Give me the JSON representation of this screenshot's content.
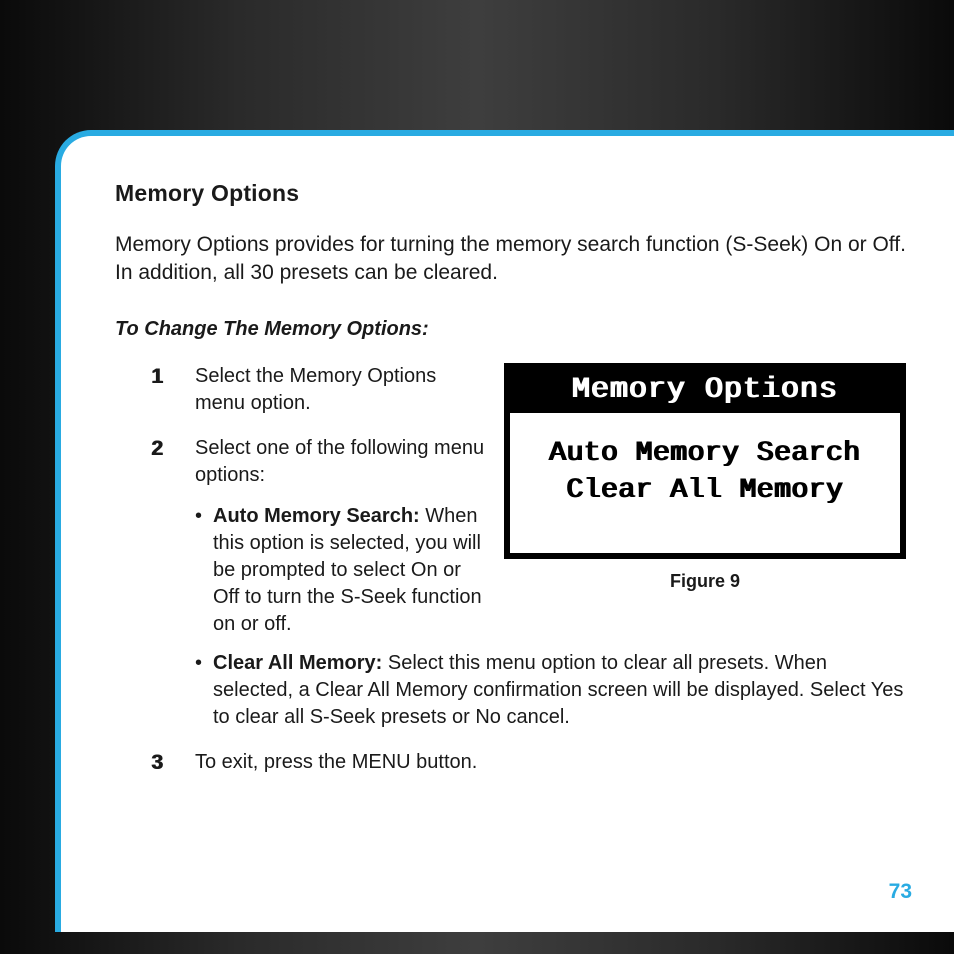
{
  "title": "Memory Options",
  "intro": "Memory Options provides for turning the memory search function (S-Seek) On or Off. In addition, all 30 presets can be cleared.",
  "subheading": "To Change The Memory Options:",
  "steps": {
    "s1": {
      "num": "1",
      "text": "Select the Memory Options menu option."
    },
    "s2": {
      "num": "2",
      "intro": "Select one of the following menu options:",
      "bullets": {
        "auto": {
          "label": "Auto Memory Search:",
          "text": " When this option is selected, you will be prompted to select On or Off to turn the S-Seek function on or off."
        },
        "clear": {
          "label": "Clear All Memory:",
          "text": " Select this menu option to clear all presets. When selected, a Clear All Memory confirmation screen will be displayed. Select Yes to clear all S-Seek presets or No cancel."
        }
      }
    },
    "s3": {
      "num": "3",
      "text": "To exit, press the MENU button."
    }
  },
  "figure": {
    "title": "Memory Options",
    "line1": "Auto Memory Search",
    "line2": "Clear All Memory",
    "caption": "Figure 9"
  },
  "page_number": "73"
}
